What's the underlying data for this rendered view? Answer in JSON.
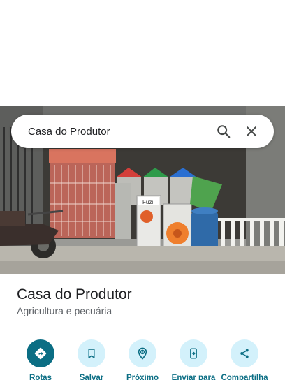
{
  "search": {
    "query": "Casa do Produtor",
    "search_icon": "search-icon",
    "clear_icon": "close-icon"
  },
  "place": {
    "name": "Casa do Produtor",
    "category": "Agricultura e pecuária",
    "photo_sign_text": "Fuzi"
  },
  "actions": [
    {
      "label": "Rotas",
      "icon": "directions-icon"
    },
    {
      "label": "Salvar",
      "icon": "bookmark-icon"
    },
    {
      "label": "Próximo",
      "icon": "nearby-icon"
    },
    {
      "label": "Enviar para",
      "icon": "send-to-phone-icon"
    },
    {
      "label": "Compartilha",
      "icon": "share-icon"
    }
  ],
  "colors": {
    "accent": "#0b6e84",
    "action_bg": "#d3f1fb"
  }
}
